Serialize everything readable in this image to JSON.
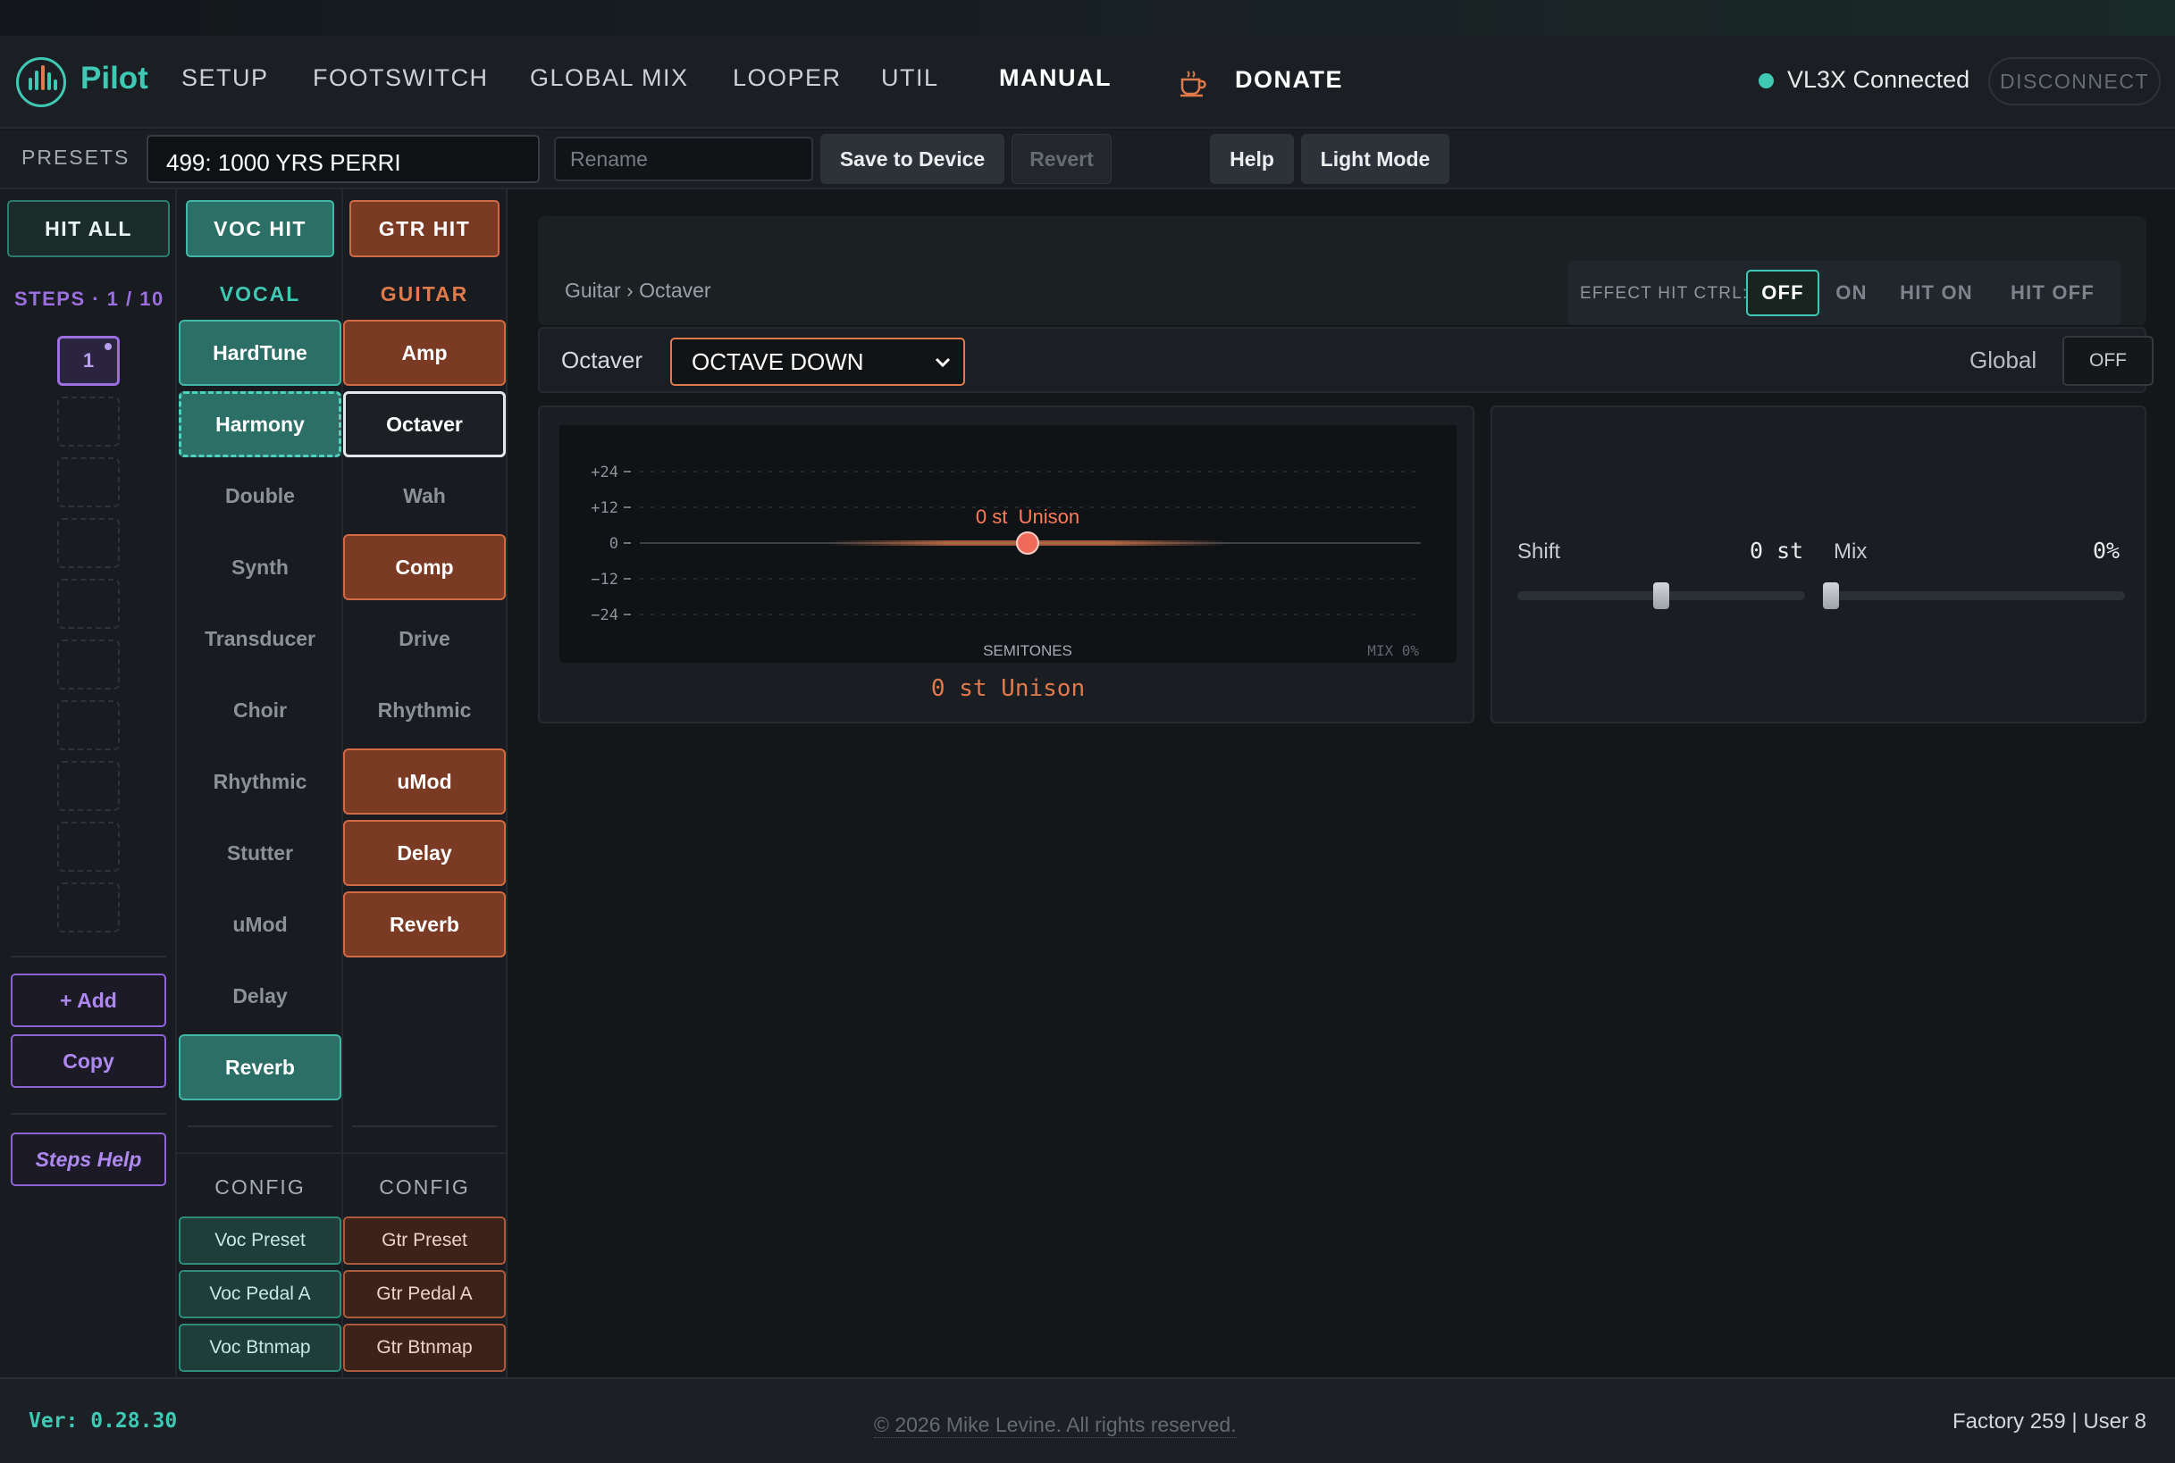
{
  "nav": {
    "brand": "Pilot",
    "items": [
      "SETUP",
      "FOOTSWITCH",
      "GLOBAL MIX",
      "LOOPER",
      "UTIL",
      "MANUAL"
    ],
    "donate": "DONATE",
    "donate_icon": "coffee-cup-icon",
    "connection": "VL3X Connected",
    "disconnect": "DISCONNECT",
    "accent": "#3fc9b4",
    "guitar_accent": "#e07a4a"
  },
  "presetbar": {
    "label": "PRESETS",
    "current": "499: 1000 YRS PERRI",
    "rename_placeholder": "Rename",
    "save": "Save to Device",
    "revert": "Revert",
    "help": "Help",
    "light_mode": "Light Mode"
  },
  "left": {
    "hit_all": "HIT ALL",
    "voc_hit": "VOC HIT",
    "gtr_hit": "GTR HIT",
    "steps": "STEPS · 1 / 10",
    "active_step": "1",
    "add": "+ Add",
    "copy": "Copy",
    "steps_help": "Steps Help",
    "vocal_header": "VOCAL",
    "guitar_header": "GUITAR",
    "vocal_effects": [
      "HardTune",
      "Harmony",
      "Double",
      "Synth",
      "Transducer",
      "Choir",
      "Rhythmic",
      "Stutter",
      "uMod",
      "Delay",
      "Reverb"
    ],
    "guitar_effects": [
      "Amp",
      "Octaver",
      "Wah",
      "Comp",
      "Drive",
      "Rhythmic",
      "uMod",
      "Delay",
      "Reverb"
    ],
    "config_label": "CONFIG",
    "vocal_config": [
      "Voc Preset",
      "Voc Pedal A",
      "Voc Btnmap"
    ],
    "guitar_config": [
      "Gtr Preset",
      "Gtr Pedal A",
      "Gtr Btnmap"
    ]
  },
  "main": {
    "breadcrumb": "Guitar › Octaver",
    "effect_hit_ctrl_label": "EFFECT HIT CTRL:",
    "effect_hit_ctrl_options": [
      "OFF",
      "ON",
      "HIT ON",
      "HIT OFF"
    ],
    "effect_hit_ctrl_selected": "OFF",
    "effect_label": "Octaver",
    "octaver_mode": "OCTAVE DOWN",
    "global_label": "Global",
    "global_value": "OFF",
    "viz": {
      "y_ticks": [
        "+24",
        "+12",
        "0",
        "−12",
        "−24"
      ],
      "marker_label": "0 st  Unison",
      "x_label": "SEMITONES",
      "mix_label": "MIX 0%",
      "readout": "0 st Unison"
    },
    "shift": {
      "label": "Shift",
      "value": "0 st"
    },
    "mix": {
      "label": "Mix",
      "value": "0%"
    }
  },
  "footer": {
    "version": "Ver: 0.28.30",
    "copyright": "© 2026 Mike Levine. All rights reserved.",
    "counts": "Factory 259 | User 8"
  }
}
